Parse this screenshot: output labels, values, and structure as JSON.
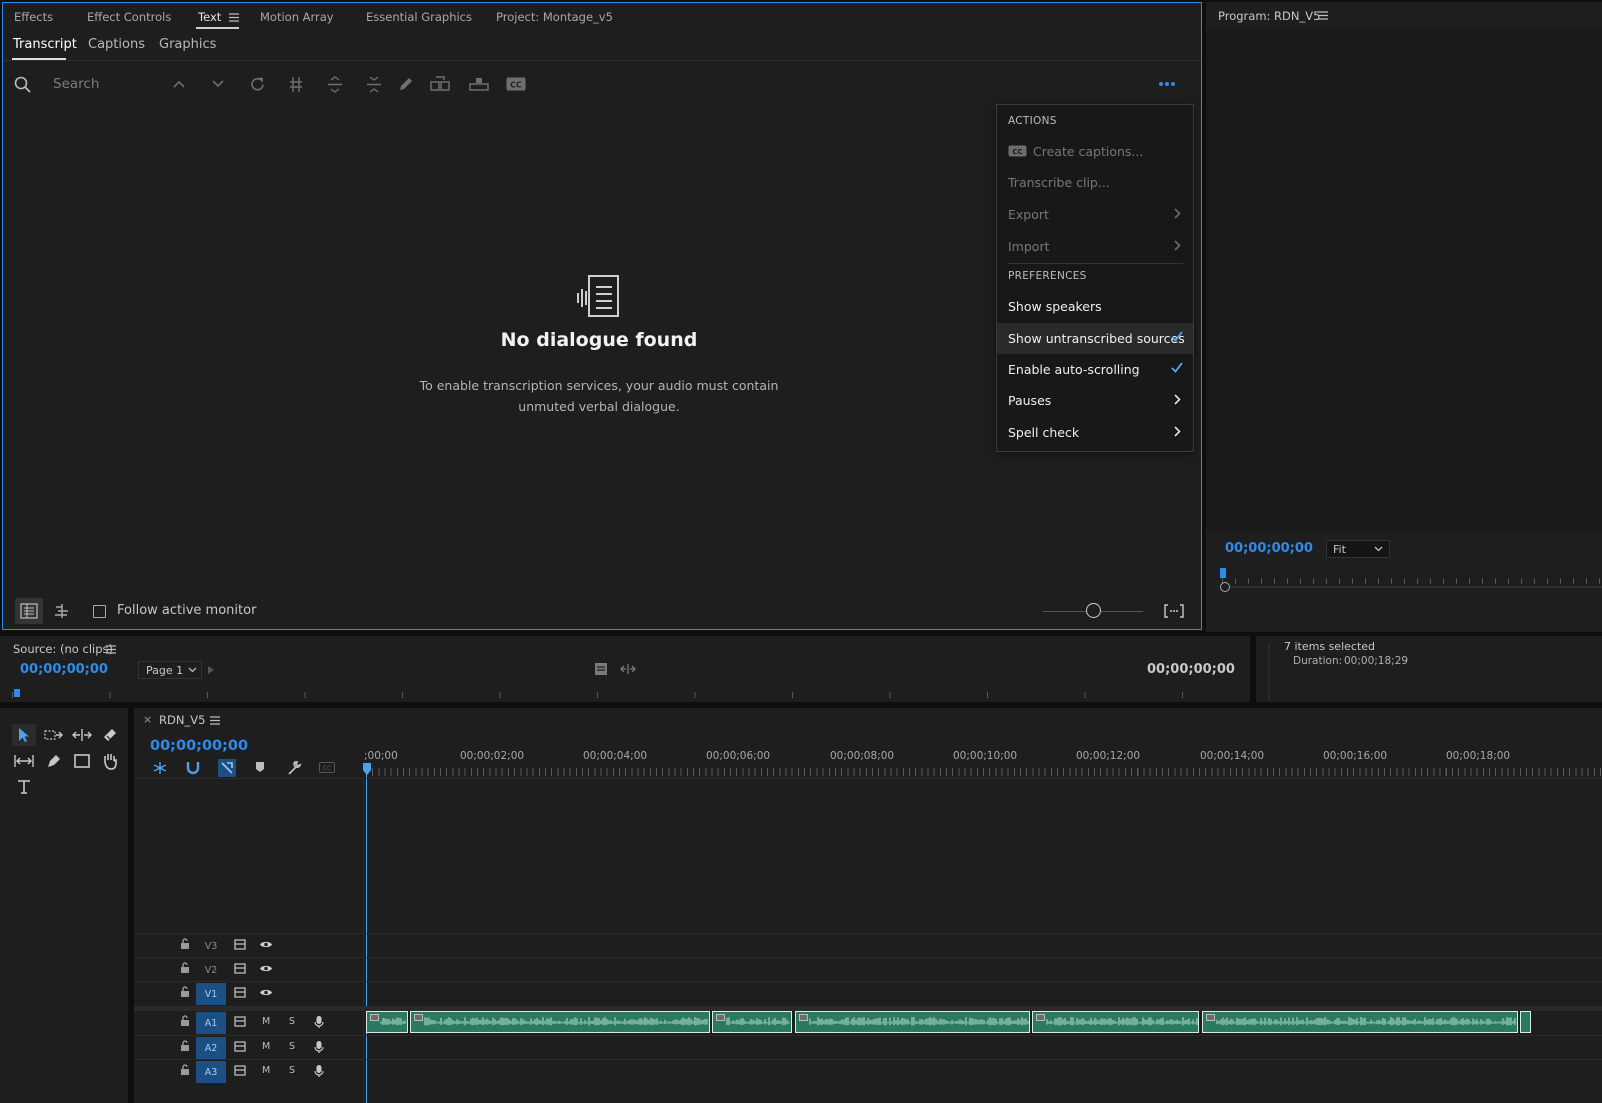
{
  "text_panel": {
    "tabs": [
      {
        "label": "Effects"
      },
      {
        "label": "Effect Controls"
      },
      {
        "label": "Text"
      },
      {
        "label": "Motion Array"
      },
      {
        "label": "Essential Graphics"
      },
      {
        "label": "Project: Montage_v5"
      }
    ],
    "subtabs": [
      {
        "label": "Transcript"
      },
      {
        "label": "Captions"
      },
      {
        "label": "Graphics"
      }
    ],
    "search_placeholder": "Search",
    "empty_title": "No dialogue found",
    "empty_line1": "To enable transcription services, your audio must contain",
    "empty_line2": "unmuted verbal dialogue.",
    "follow_active_monitor": "Follow active monitor",
    "follow_checked": false
  },
  "menu": {
    "actions_header": "ACTIONS",
    "create_captions": "Create captions...",
    "transcribe_clip": "Transcribe clip...",
    "export": "Export",
    "import": "Import",
    "preferences_header": "PREFERENCES",
    "show_speakers": "Show speakers",
    "show_untranscribed": "Show untranscribed sources",
    "enable_autoscroll": "Enable auto-scrolling",
    "pauses": "Pauses",
    "spell_check": "Spell check",
    "accent": "#5aa6f0"
  },
  "program": {
    "title": "Program: RDN_V5",
    "timecode": "00;00;00;00",
    "fit": "Fit"
  },
  "source": {
    "title": "Source: (no clips)",
    "timecode_left": "00;00;00;00",
    "page": "Page 1",
    "timecode_right": "00;00;00;00"
  },
  "info": {
    "selected": "7 items selected",
    "duration_label": "Duration:",
    "duration_value": "00;00;18;29"
  },
  "timeline": {
    "sequence": "RDN_V5",
    "timecode": "00;00;00;00",
    "ruler": [
      ";00;00",
      "00;00;02;00",
      "00;00;04;00",
      "00;00;06;00",
      "00;00;08;00",
      "00;00;10;00",
      "00;00;12;00",
      "00;00;14;00",
      "00;00;16;00",
      "00;00;18;00"
    ],
    "tracks": {
      "v3": "V3",
      "v2": "V2",
      "v1": "V1",
      "a1": "A1",
      "a2": "A2",
      "a3": "A3",
      "m": "M",
      "s": "S"
    }
  },
  "colors": {
    "accent": "#2d8ceb",
    "panel": "#1e1e1e",
    "clip": "#2a7a62"
  }
}
